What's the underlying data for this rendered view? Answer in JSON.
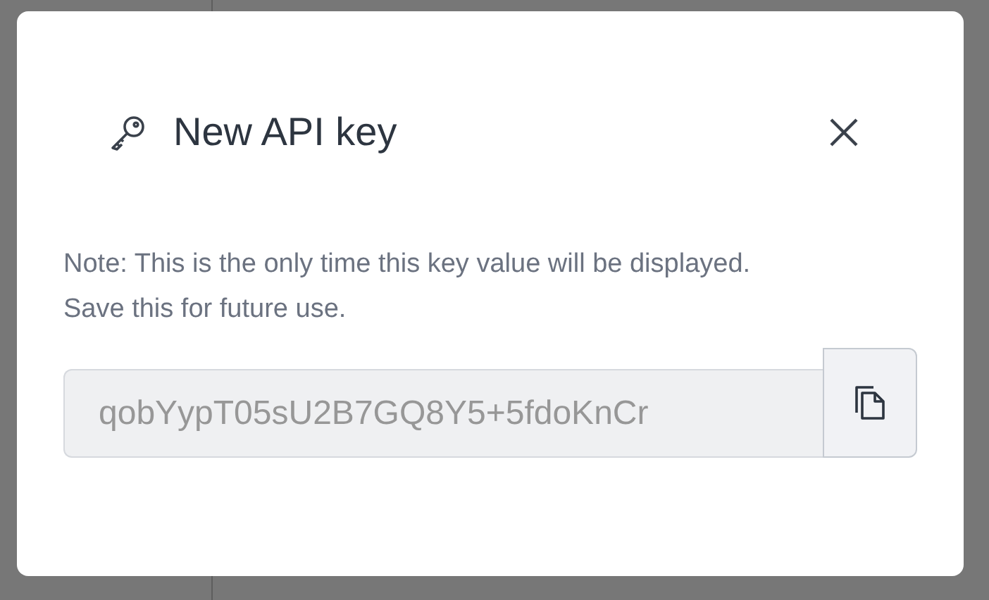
{
  "dialog": {
    "title": "New API key",
    "note": "Note: This is the only time this key value will be displayed. Save this for future use.",
    "key_field": {
      "value": "qobYypT05sU2B7GQ8Y5+5fdoKnCr",
      "disabled": true
    }
  }
}
